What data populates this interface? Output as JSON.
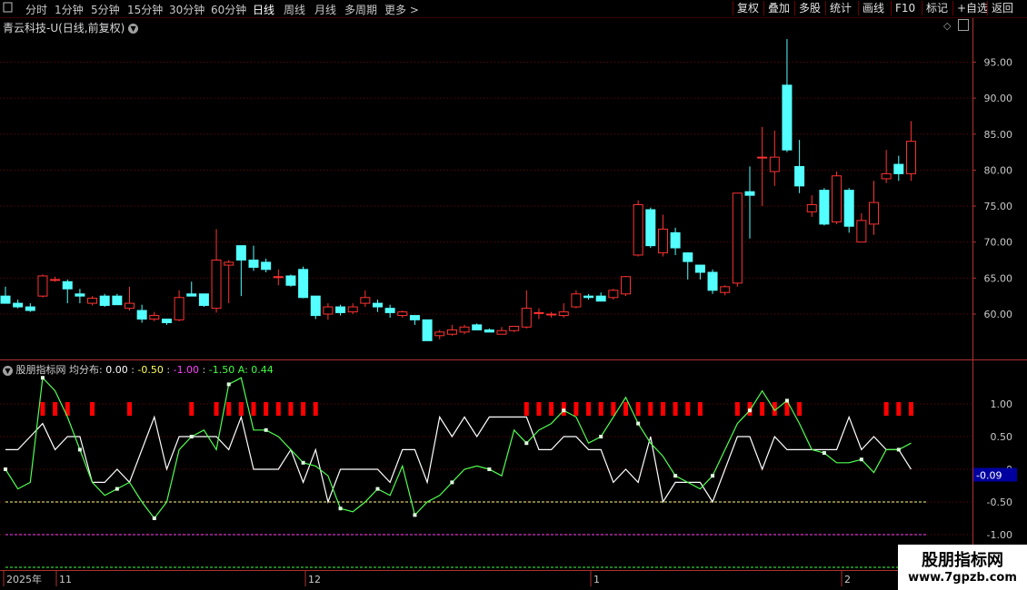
{
  "toolbar": {
    "periods": [
      "分时",
      "1分钟",
      "5分钟",
      "15分钟",
      "30分钟",
      "60分钟",
      "日线",
      "周线",
      "月线",
      "多周期",
      "更多 >"
    ],
    "active_period": "日线",
    "buttons": [
      "复权",
      "叠加",
      "多股",
      "统计",
      "画线",
      "F10",
      "标记",
      "+自选",
      "返回"
    ]
  },
  "stock_title": "青云科技-U(日线,前复权)",
  "indicator": {
    "name": "股朋指标网",
    "label": "均分布:",
    "values": [
      "0.00",
      "-0.50",
      "-1.00",
      "-1.50"
    ],
    "a_label": "A: 0.44",
    "current_value": "-0.09"
  },
  "colors": {
    "up": "#ff3232",
    "down": "#54ffff",
    "white_line": "#ffffff",
    "green_line": "#50ff50",
    "grid": "#7a0000",
    "axis": "#b03030",
    "axis_text": "#c8c8c8"
  },
  "price_axis": {
    "ticks": [
      "95.00",
      "90.00",
      "85.00",
      "80.00",
      "75.00",
      "70.00",
      "65.00",
      "60.00"
    ]
  },
  "indicator_axis": {
    "ticks": [
      "1.00",
      "0.50",
      "0",
      "-0.50",
      "-1.00"
    ]
  },
  "date_axis": {
    "labels": [
      "2025年",
      "11",
      "12",
      "1",
      "2"
    ]
  },
  "chart_data": {
    "type": "candlestick",
    "ylim": [
      54,
      100
    ],
    "candles": [
      [
        62.5,
        63.8,
        61.5,
        61.5
      ],
      [
        61.5,
        62,
        60.8,
        61
      ],
      [
        61,
        61.5,
        60.3,
        60.5
      ],
      [
        62.5,
        65.5,
        62.3,
        65.3
      ],
      [
        64.8,
        65.2,
        64.5,
        64.8
      ],
      [
        64.5,
        64.8,
        61.5,
        63.5
      ],
      [
        62.8,
        63.5,
        61.5,
        62.5
      ],
      [
        61.5,
        62.5,
        61.2,
        62.2
      ],
      [
        62.5,
        62.8,
        61,
        61.2
      ],
      [
        62.5,
        62.8,
        61.3,
        61.3
      ],
      [
        60.8,
        63.8,
        60.5,
        61.5
      ],
      [
        60.5,
        61.3,
        58.8,
        59.3
      ],
      [
        59.3,
        60.3,
        59,
        59.8
      ],
      [
        59.3,
        59.3,
        58.5,
        58.8
      ],
      [
        59.2,
        63.3,
        59,
        62.3
      ],
      [
        62.8,
        64.5,
        62.5,
        62.5
      ],
      [
        62.8,
        62.8,
        61,
        61.2
      ],
      [
        60.8,
        71.8,
        60.2,
        67.5
      ],
      [
        66.8,
        67.5,
        61.5,
        67.2
      ],
      [
        69.5,
        69.5,
        62.5,
        67.5
      ],
      [
        67.5,
        69.5,
        66,
        66.5
      ],
      [
        67.2,
        67.7,
        65.8,
        66.2
      ],
      [
        65.2,
        66.2,
        64,
        65.2
      ],
      [
        65.3,
        65.5,
        63.8,
        64
      ],
      [
        66.2,
        66.6,
        62.2,
        62.3
      ],
      [
        62.5,
        62.5,
        59.3,
        59.8
      ],
      [
        60,
        61.5,
        59.2,
        61
      ],
      [
        61,
        61.3,
        59.8,
        60.2
      ],
      [
        60.3,
        61.5,
        60,
        61
      ],
      [
        61.5,
        63.3,
        61,
        62.3
      ],
      [
        61.5,
        62,
        60.3,
        61
      ],
      [
        60.8,
        61.3,
        59.5,
        60.2
      ],
      [
        59.8,
        60.5,
        59.5,
        60.3
      ],
      [
        59.8,
        59.8,
        58.5,
        59.2
      ],
      [
        59.2,
        59.2,
        56.3,
        56.3
      ],
      [
        57,
        57.8,
        56.5,
        57.5
      ],
      [
        57.2,
        58.5,
        57,
        57.8
      ],
      [
        57.5,
        58.5,
        57.2,
        58.2
      ],
      [
        58.5,
        58.7,
        57.8,
        57.8
      ],
      [
        57.8,
        58,
        57.5,
        57.5
      ],
      [
        57.2,
        58.2,
        57.2,
        57.7
      ],
      [
        57.7,
        58.2,
        57.5,
        58.3
      ],
      [
        58.2,
        63.3,
        58,
        60.8
      ],
      [
        60.2,
        60.8,
        59.3,
        60.2
      ],
      [
        60,
        60.3,
        59.5,
        60
      ],
      [
        59.8,
        61.5,
        59.5,
        60.3
      ],
      [
        61,
        63.3,
        60.8,
        62.8
      ],
      [
        62.5,
        62.8,
        62,
        62.3
      ],
      [
        62.5,
        63,
        61.8,
        61.8
      ],
      [
        62.3,
        63.5,
        62,
        63.3
      ],
      [
        62.8,
        65.3,
        62.5,
        65.2
      ],
      [
        68.2,
        75.8,
        68,
        75.2
      ],
      [
        74.5,
        74.8,
        69.2,
        69.5
      ],
      [
        68.5,
        73.8,
        68,
        71.8
      ],
      [
        71.3,
        72,
        68.2,
        69.2
      ],
      [
        68.5,
        68.6,
        64.8,
        67.3
      ],
      [
        66.8,
        66.8,
        64.8,
        65.8
      ],
      [
        65.8,
        66.2,
        62.8,
        63.3
      ],
      [
        63,
        64,
        62.6,
        63.8
      ],
      [
        64.3,
        76.8,
        63.8,
        76.8
      ],
      [
        77,
        80.5,
        70.5,
        76.5
      ],
      [
        81.8,
        86,
        75,
        81.8
      ],
      [
        79.8,
        85.5,
        77.8,
        81.8
      ],
      [
        91.8,
        98.2,
        82.5,
        82.8
      ],
      [
        80.5,
        84.2,
        76.8,
        77.8
      ],
      [
        74.2,
        76.5,
        73.5,
        75.2
      ],
      [
        77.2,
        77.5,
        72.3,
        72.5
      ],
      [
        72.8,
        79.8,
        72.5,
        79.2
      ],
      [
        77.2,
        77.5,
        71.3,
        72.2
      ],
      [
        70,
        74,
        70,
        73
      ],
      [
        72.5,
        78.5,
        71,
        75.5
      ],
      [
        78.8,
        82.8,
        78.2,
        79.5
      ],
      [
        80.8,
        82,
        78.5,
        79.5
      ],
      [
        79.5,
        86.8,
        78.5,
        84
      ]
    ],
    "white_line": [
      0.3,
      0.3,
      0.5,
      0.7,
      0.3,
      0.5,
      0.5,
      -0.2,
      -0.2,
      0,
      -0.2,
      0.3,
      0.8,
      0,
      0.5,
      0.5,
      0.5,
      0.5,
      0.3,
      0.8,
      0,
      0,
      0,
      0.3,
      -0.2,
      0.3,
      -0.5,
      0,
      0,
      0,
      0,
      -0.2,
      0.3,
      0.3,
      -0.2,
      0.8,
      0.5,
      0.8,
      0.5,
      0.8,
      0.8,
      0.8,
      0.8,
      0.3,
      0.3,
      0.5,
      0.5,
      0.3,
      0.3,
      -0.2,
      0,
      -0.2,
      0.5,
      -0.5,
      -0.2,
      -0.2,
      -0.2,
      -0.5,
      0,
      0.5,
      0.5,
      0,
      0.5,
      0.3,
      0.3,
      0.3,
      0.3,
      0.3,
      0.8,
      0.3,
      0.5,
      0.3,
      0.3,
      0
    ],
    "green_line": [
      0,
      -0.3,
      -0.2,
      1.4,
      1.2,
      0.8,
      0.3,
      -0.2,
      -0.4,
      -0.3,
      -0.2,
      -0.5,
      -0.75,
      -0.5,
      0.3,
      0.5,
      0.6,
      0.3,
      1.3,
      1.4,
      0.6,
      0.6,
      0.5,
      0.3,
      0.1,
      0.05,
      -0.1,
      -0.6,
      -0.65,
      -0.5,
      -0.3,
      -0.4,
      0.05,
      -0.7,
      -0.5,
      -0.4,
      -0.2,
      0,
      0.05,
      0,
      -0.1,
      0.6,
      0.4,
      0.6,
      0.7,
      0.9,
      0.8,
      0.4,
      0.5,
      0.8,
      1.1,
      0.7,
      0.4,
      0.2,
      -0.1,
      -0.2,
      -0.3,
      -0.1,
      0.3,
      0.7,
      0.9,
      1.2,
      0.9,
      1.05,
      0.7,
      0.3,
      0.25,
      0.1,
      0.1,
      0.15,
      -0.05,
      0.3,
      0.3,
      0.4
    ],
    "red_markers": [
      3,
      4,
      5,
      7,
      10,
      15,
      17,
      18,
      19,
      20,
      21,
      22,
      23,
      24,
      25,
      42,
      43,
      44,
      45,
      46,
      47,
      48,
      49,
      50,
      51,
      52,
      53,
      54,
      55,
      56,
      59,
      60,
      61,
      62,
      63,
      64,
      71,
      72,
      73
    ],
    "dashed_levels": [
      {
        "value": -0.5,
        "color": "#ffff80"
      },
      {
        "value": -1.0,
        "color": "#ff40ff"
      },
      {
        "value": -1.5,
        "color": "#40ff40"
      }
    ]
  }
}
